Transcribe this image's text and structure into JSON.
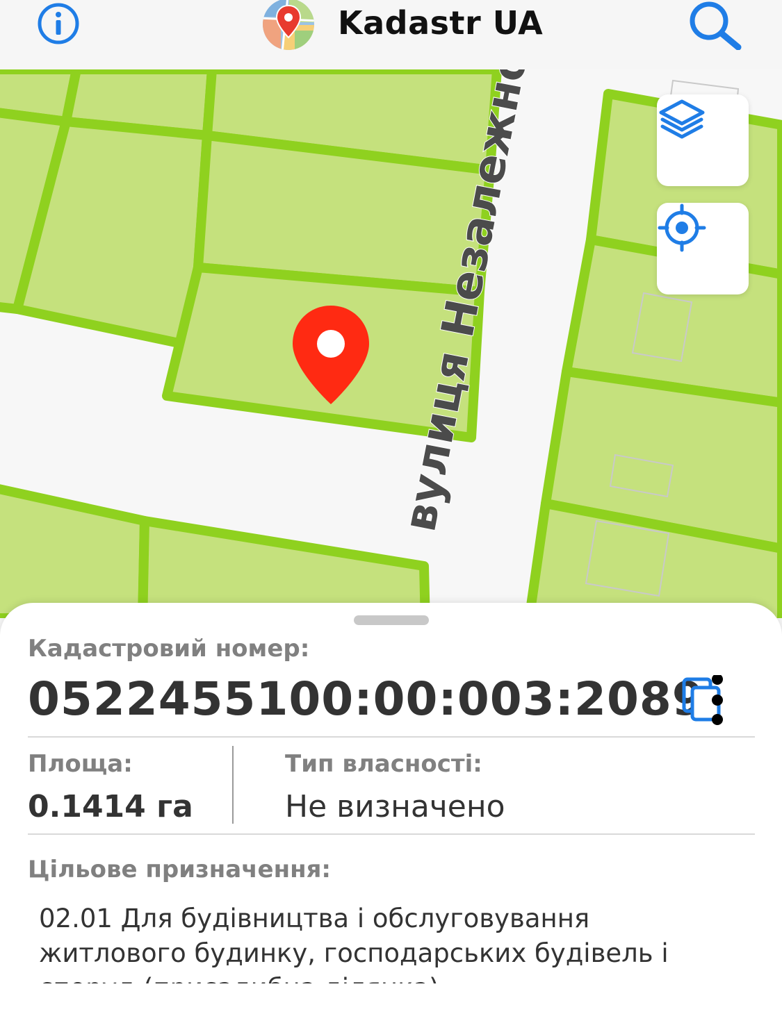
{
  "header": {
    "title": "Kadastr UA",
    "accent_color": "#1f7de6"
  },
  "map": {
    "street_name": "вулиця Незалежнос",
    "parcel_fill": "#c5e17d",
    "parcel_border": "#8fd11f",
    "marker_color": "#ff2a12"
  },
  "parcel": {
    "cadastral_label": "Кадастровий номер:",
    "cadastral_number": "0522455100:00:003:2089",
    "area_label": "Площа:",
    "area_value": "0.1414 га",
    "ownership_label": "Тип власності:",
    "ownership_value": "Не визначено",
    "purpose_label": "Цільове призначення:",
    "purpose_text": "02.01 Для будівництва і обслуговування житлового будинку, господарських будівель і споруд (присадибна ділянка)"
  },
  "icons": [
    "info-icon",
    "app-logo-icon",
    "search-icon",
    "layers-icon",
    "locate-icon",
    "map-pin-icon",
    "copy-icon"
  ]
}
